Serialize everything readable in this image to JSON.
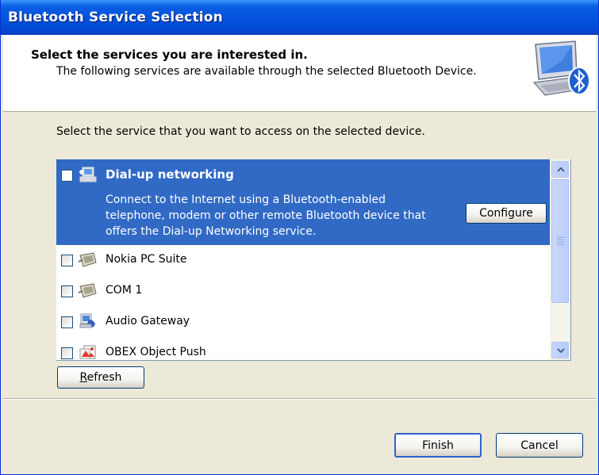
{
  "window": {
    "title": "Bluetooth Service Selection"
  },
  "header": {
    "title": "Select the services you are interested in.",
    "subtitle": "The following services are available through the selected Bluetooth Device.",
    "icon": "bluetooth-computer-icon"
  },
  "instruction": "Select the service that you want to access on the selected device.",
  "services": [
    {
      "name": "Dial-up networking",
      "icon": "dialup-networking-icon",
      "checked": false,
      "selected": true,
      "description_lines": [
        "Connect to the Internet using a Bluetooth-enabled",
        "telephone, modem or other remote Bluetooth device that",
        "offers the Dial-up Networking service."
      ],
      "configure_label": "Configure"
    },
    {
      "name": "Nokia PC Suite",
      "icon": "serial-port-icon",
      "checked": false,
      "selected": false
    },
    {
      "name": "COM 1",
      "icon": "serial-port-icon",
      "checked": false,
      "selected": false
    },
    {
      "name": "Audio Gateway",
      "icon": "audio-gateway-icon",
      "checked": false,
      "selected": false
    },
    {
      "name": "OBEX Object Push",
      "icon": "obex-push-icon",
      "checked": false,
      "selected": false
    }
  ],
  "buttons": {
    "refresh_first": "R",
    "refresh_rest": "efresh",
    "finish": "Finish",
    "cancel": "Cancel"
  },
  "colors": {
    "titlebar": "#0454e0",
    "selection": "#316ac5",
    "face": "#ece9d8"
  }
}
